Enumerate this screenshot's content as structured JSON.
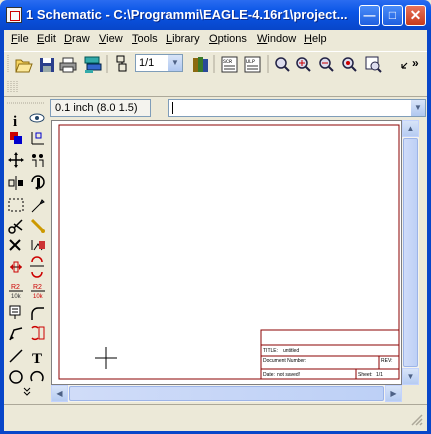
{
  "window": {
    "title": "1 Schematic - C:\\Programmi\\EAGLE-4.16r1\\project...",
    "controls": [
      "minimize",
      "maximize",
      "close"
    ]
  },
  "menu": [
    {
      "label": "File",
      "key": "F",
      "rest": "ile"
    },
    {
      "label": "Edit",
      "key": "E",
      "rest": "dit"
    },
    {
      "label": "Draw",
      "key": "D",
      "rest": "raw"
    },
    {
      "label": "View",
      "key": "V",
      "rest": "iew"
    },
    {
      "label": "Tools",
      "key": "T",
      "rest": "ools"
    },
    {
      "label": "Library",
      "key": "L",
      "rest": "ibrary"
    },
    {
      "label": "Options",
      "key": "O",
      "rest": "ptions"
    },
    {
      "label": "Window",
      "key": "W",
      "rest": "indow"
    },
    {
      "label": "Help",
      "key": "H",
      "rest": "elp"
    }
  ],
  "toolbar": {
    "sheet_select": "1/1",
    "overflow": "»"
  },
  "coordinates": "0.1 inch (8.0 1.5)",
  "command_line": {
    "value": ""
  },
  "title_block": {
    "title_label": "TITLE:",
    "title_value": "untitled",
    "document_number_label": "Document Number:",
    "rev_label": "REV:",
    "date_label": "Date:",
    "date_value": "not saved!",
    "sheet_label": "Sheet:",
    "sheet_value": "1/1"
  },
  "palette": {
    "name_tool": "R2",
    "value_tool": "10k",
    "value_tool2": "10k",
    "text_tool": "T"
  },
  "colors": {
    "frame_red": "#8B0000",
    "title_bar": "#0A55E6",
    "window_bg": "#ECE9D8"
  }
}
